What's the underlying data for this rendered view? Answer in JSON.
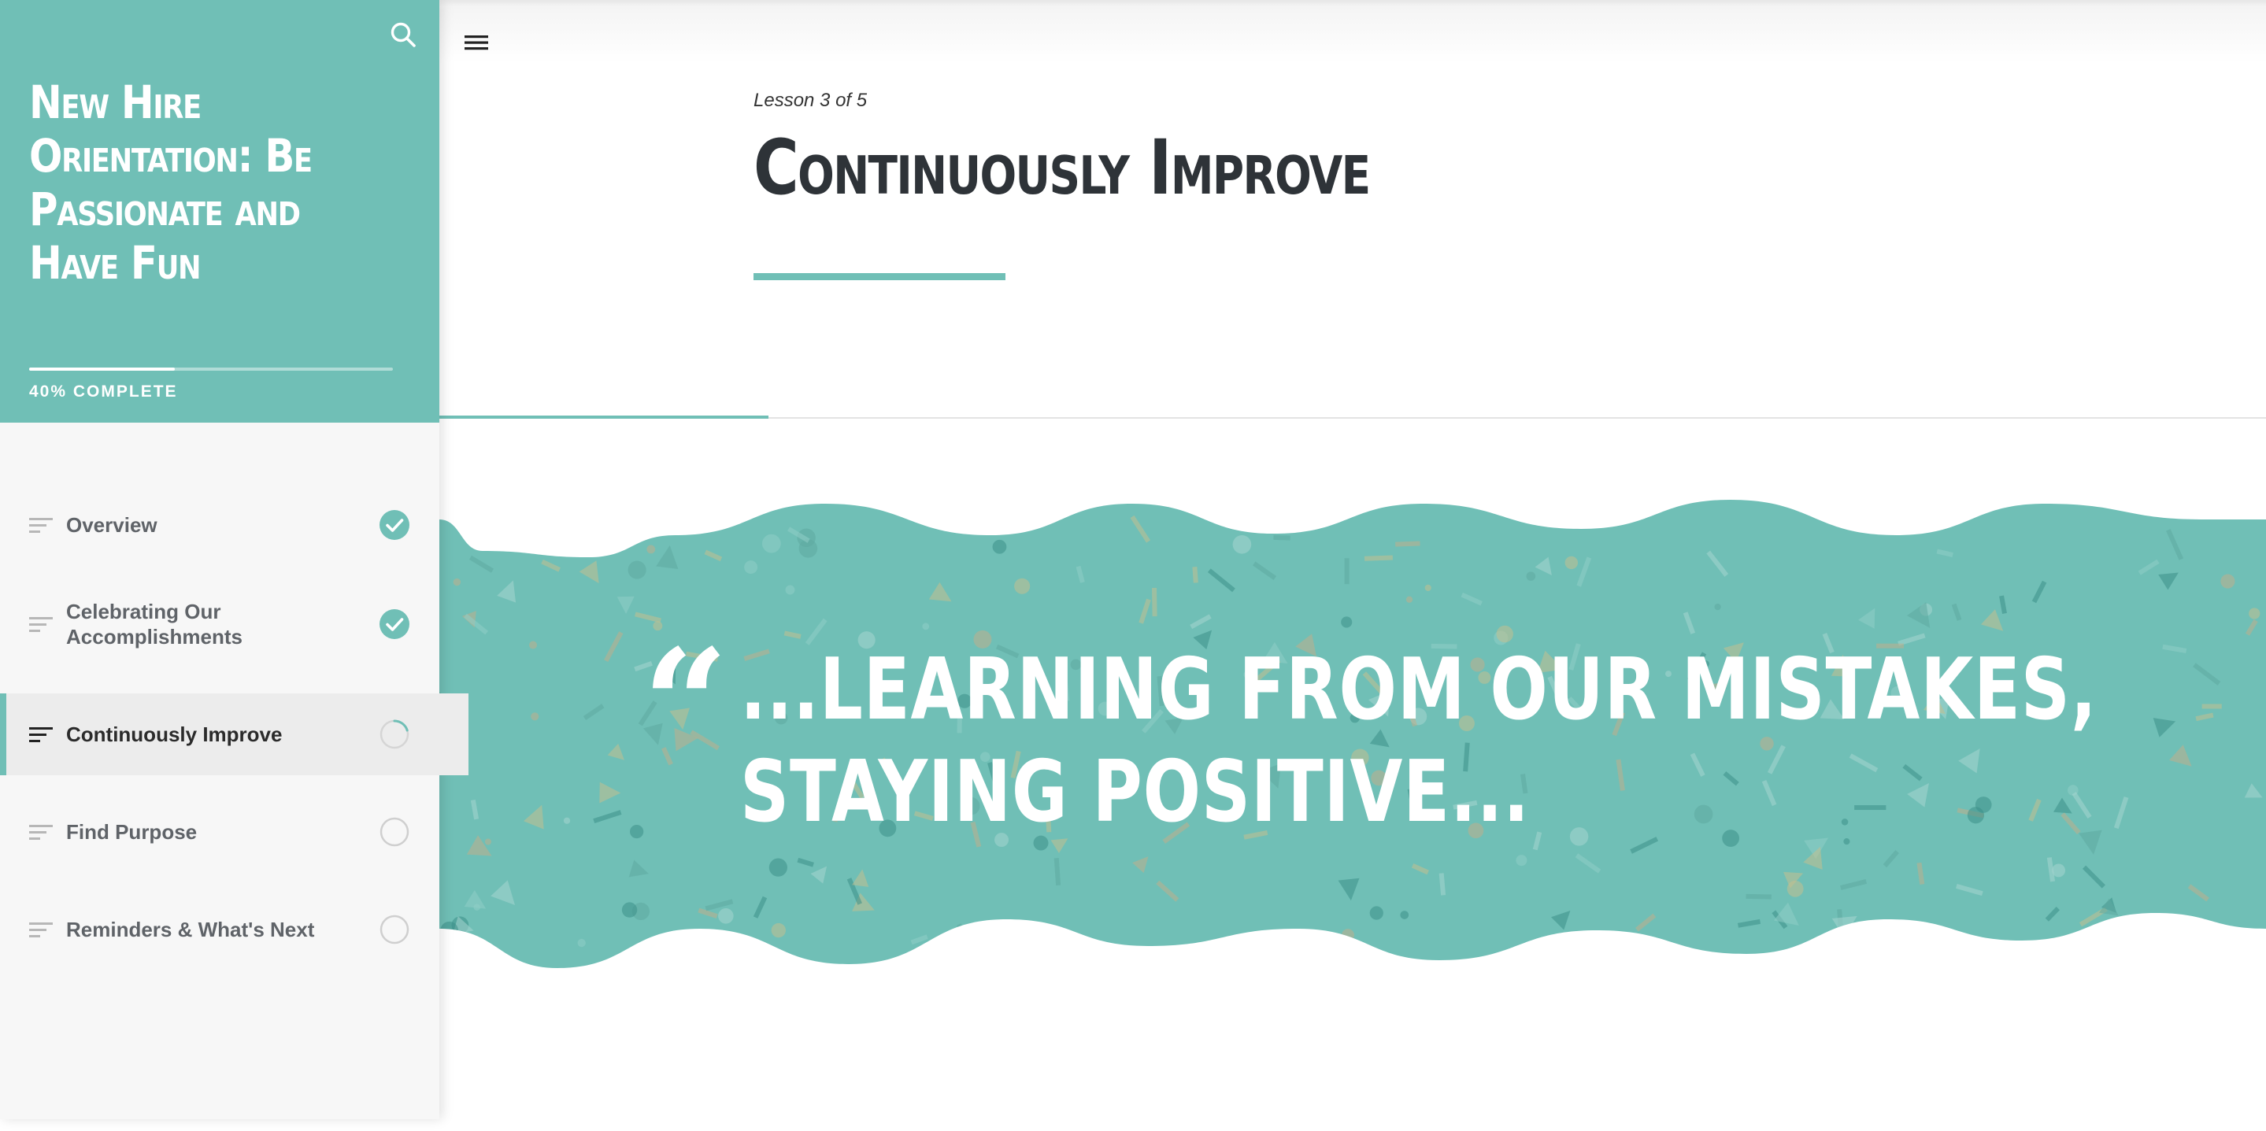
{
  "colors": {
    "accent": "#70bfb6",
    "title_text": "#2e3338",
    "nav_text": "#5f6368"
  },
  "sidebar": {
    "search_icon": "search-icon",
    "course_title": "New Hire Orientation: Be Passionate and Have Fun",
    "progress_percent": 40,
    "progress_label": "40% COMPLETE",
    "items": [
      {
        "label": "Overview",
        "status": "complete"
      },
      {
        "label": "Celebrating Our Accomplishments",
        "status": "complete"
      },
      {
        "label": "Continuously Improve",
        "status": "in-progress"
      },
      {
        "label": "Find Purpose",
        "status": "not-started"
      },
      {
        "label": "Reminders & What's Next",
        "status": "not-started"
      }
    ]
  },
  "main": {
    "menu_icon": "hamburger-menu-icon",
    "lesson_counter": "Lesson 3 of 5",
    "lesson_title": "Continuously Improve",
    "scroll_progress": 0.18,
    "quote": {
      "mark": "“",
      "line1": "...LEARNING FROM OUR MISTAKES,",
      "line2": "STAYING POSITIVE..."
    }
  }
}
